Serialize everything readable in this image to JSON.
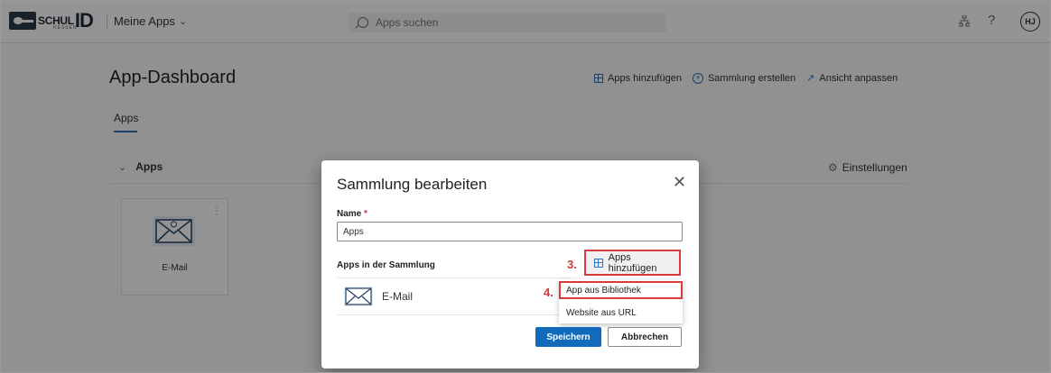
{
  "brand": {
    "logo_text": "SCHUL",
    "logo_id": "ID",
    "logo_sub": "HESSEN"
  },
  "header": {
    "menu_label": "Meine Apps",
    "user_initials": "HJ"
  },
  "search": {
    "placeholder": "Apps suchen"
  },
  "page": {
    "title": "App-Dashboard",
    "actions": {
      "add_apps": "Apps hinzufügen",
      "create_collection": "Sammlung erstellen",
      "customize_view": "Ansicht anpassen"
    },
    "tab": "Apps",
    "section_title": "Apps",
    "settings_label": "Einstellungen",
    "tiles": [
      {
        "label": "E-Mail"
      }
    ]
  },
  "modal": {
    "title": "Sammlung bearbeiten",
    "name_label": "Name",
    "required_mark": "*",
    "name_value": "Apps",
    "apps_label": "Apps in der Sammlung",
    "step3": "3.",
    "add_apps_button": "Apps hinzufügen",
    "step4": "4.",
    "apps": [
      {
        "label": "E-Mail"
      }
    ],
    "dropdown": {
      "items": [
        {
          "label": "App aus Bibliothek"
        },
        {
          "label": "Website aus URL"
        }
      ]
    },
    "save_button": "Speichern",
    "cancel_button": "Abbrechen"
  },
  "colors": {
    "accent": "#0f6cbd",
    "highlight": "#d83b3b"
  }
}
